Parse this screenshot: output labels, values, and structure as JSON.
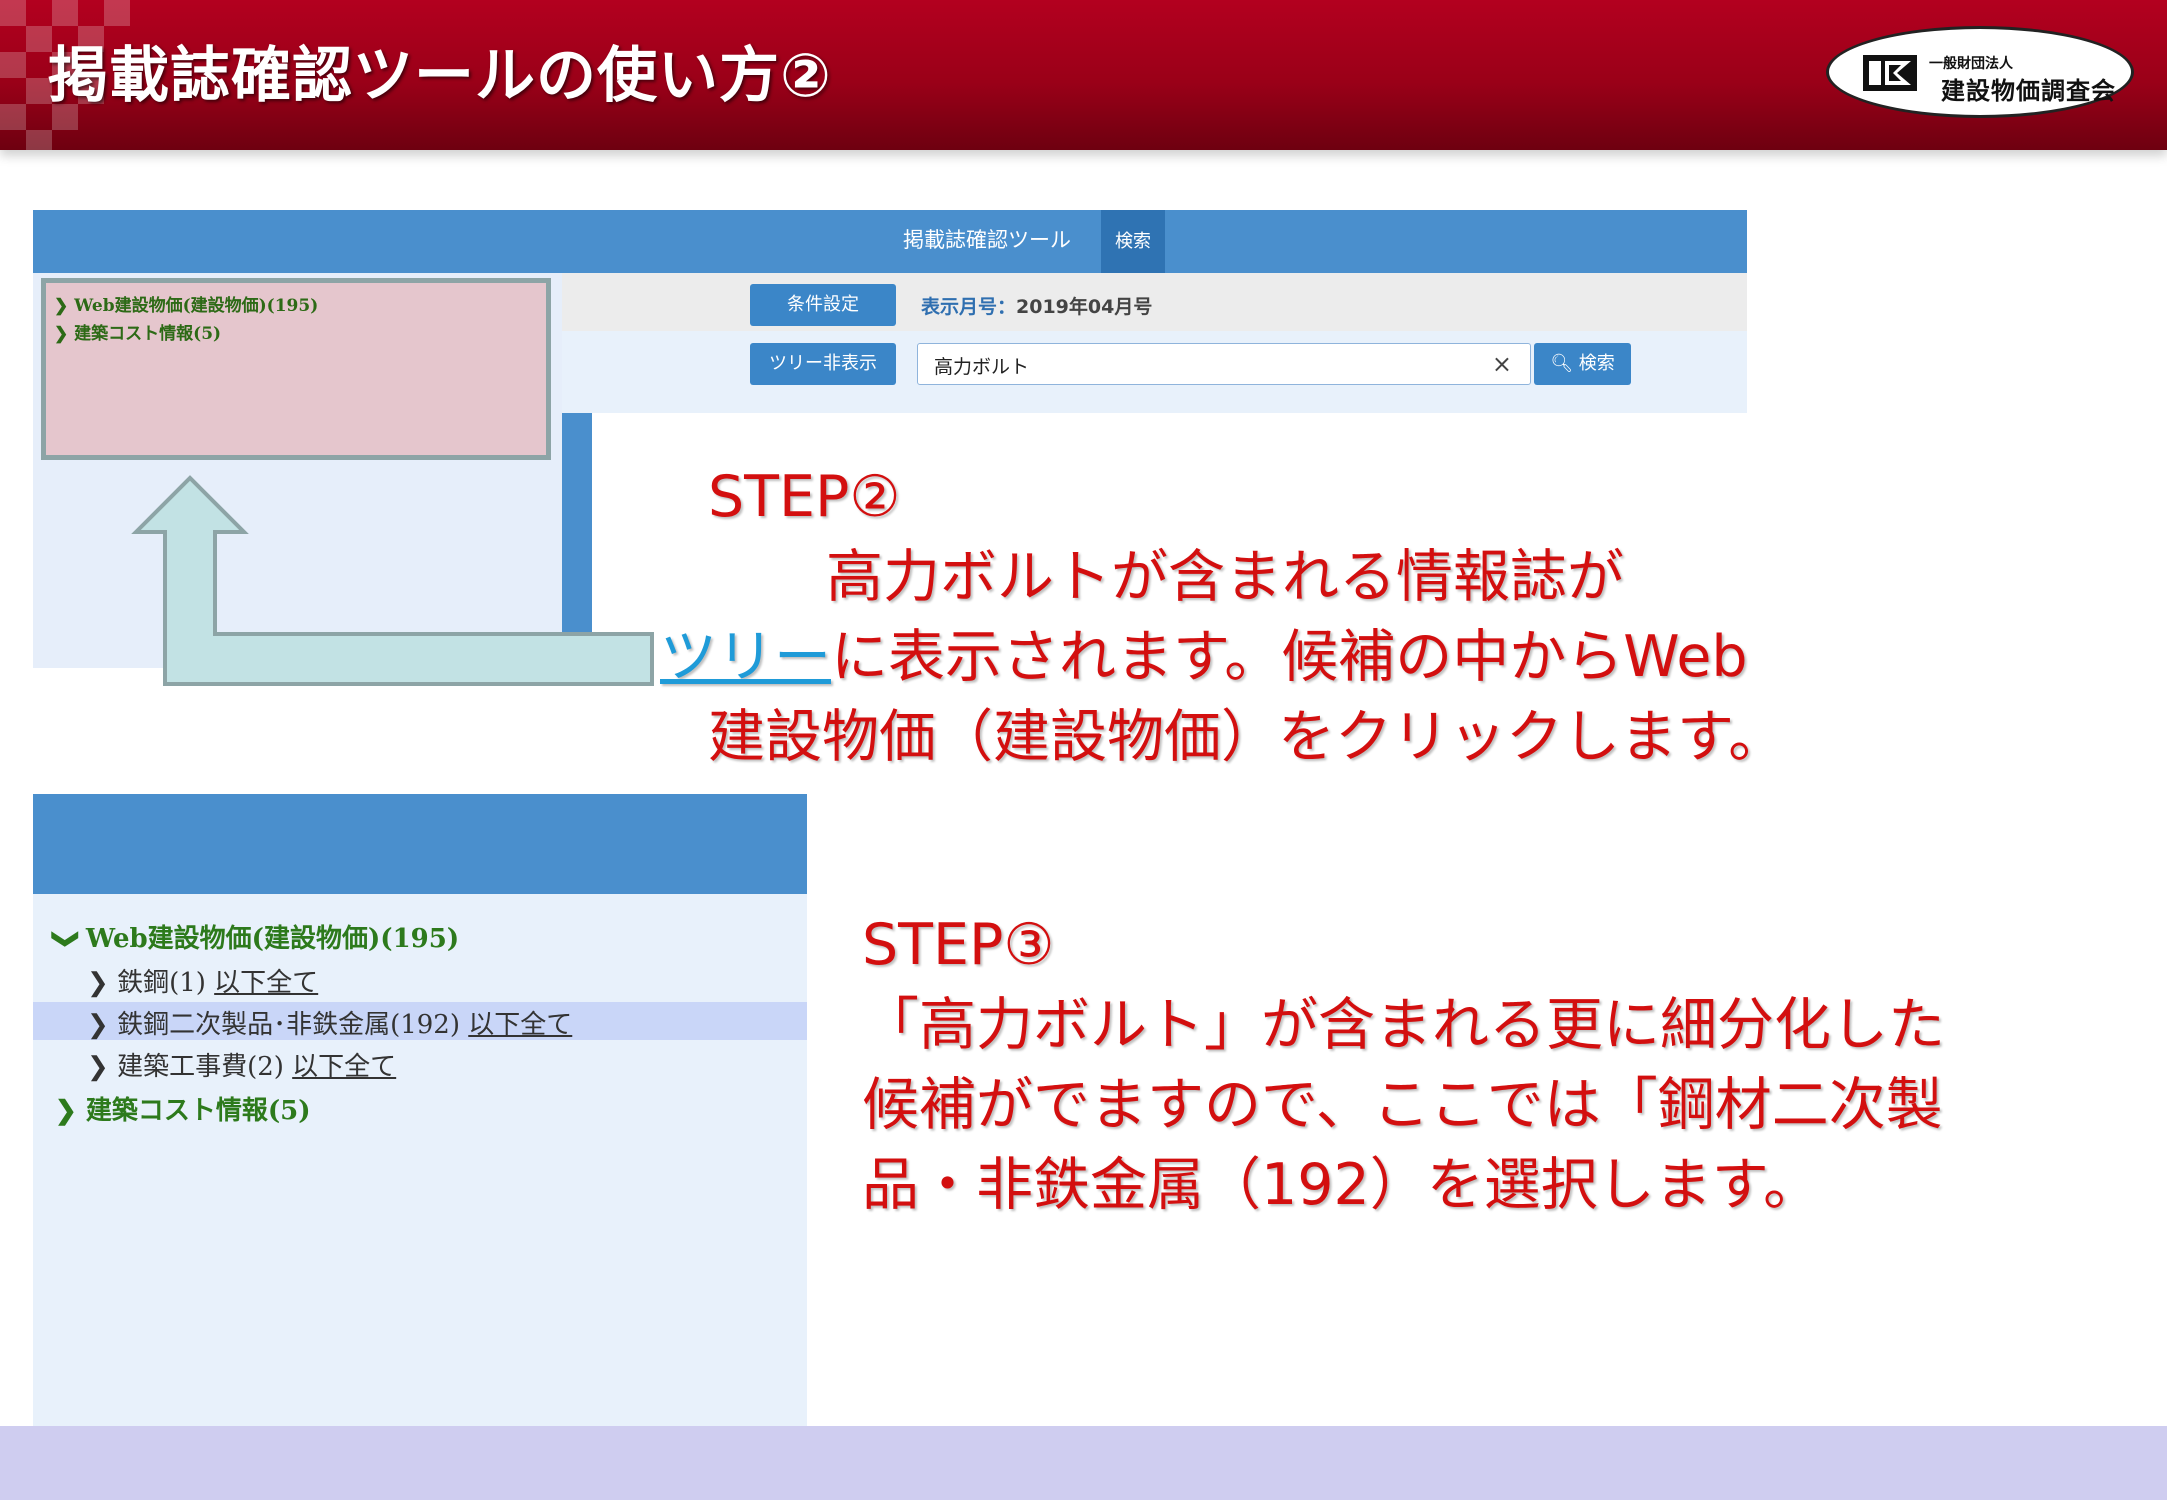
{
  "banner": {
    "title": "掲載誌確認ツールの使い方②",
    "logo_sub": "一般財団法人",
    "logo_main": "建設物価調査会"
  },
  "screen1": {
    "app_title": "掲載誌確認ツール",
    "search_tab": "検索",
    "tree": [
      "Web建設物価(建設物価)(195)",
      "建築コスト情報(5)"
    ],
    "condition_button": "条件設定",
    "month_label": "表示月号：",
    "month_value": "2019年04月号",
    "tree_toggle_button": "ツリー非表示",
    "search_value": "高力ボルト",
    "clear_symbol": "×",
    "search_button": "検索"
  },
  "step2": {
    "heading": "STEP②",
    "line1": "高力ボルトが含まれる情報誌が",
    "link_word": "ツリー",
    "line2_rest": "に表示されます。候補の中からWeb",
    "line3": "建設物価（建設物価）をクリックします。"
  },
  "screen2": {
    "root": "Web建設物価(建設物価)(195)",
    "children": [
      {
        "label": "鉄鋼(1)",
        "link": "以下全て"
      },
      {
        "label": "鉄鋼二次製品･非鉄金属(192)",
        "link": "以下全て"
      },
      {
        "label": "建築工事費(2)",
        "link": "以下全て"
      }
    ],
    "other": "建築コスト情報(5)"
  },
  "step3": {
    "heading": "STEP③",
    "line1": "「高力ボルト」が含まれる更に細分化した",
    "line2": "候補がでますので、ここでは「鋼材二次製",
    "line3": "品・非鉄金属（192）を選択します。"
  },
  "colors": {
    "banner_red": "#a00018",
    "step_red": "#d30f0f",
    "ui_blue": "#4a8fcd",
    "tree_green": "#2d7a1c",
    "link_blue": "#1f9bd8"
  }
}
